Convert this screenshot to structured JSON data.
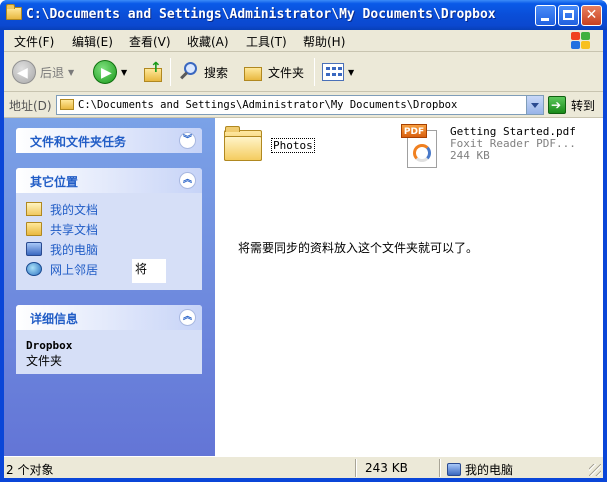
{
  "window": {
    "title": "C:\\Documents and Settings\\Administrator\\My Documents\\Dropbox"
  },
  "menubar": {
    "items": [
      "文件(F)",
      "编辑(E)",
      "查看(V)",
      "收藏(A)",
      "工具(T)",
      "帮助(H)"
    ]
  },
  "toolbar": {
    "back_label": "后退",
    "search_label": "搜索",
    "folders_label": "文件夹"
  },
  "addressbar": {
    "label": "地址(D)",
    "value": "C:\\Documents and Settings\\Administrator\\My Documents\\Dropbox",
    "go_label": "转到"
  },
  "tasks": {
    "file_tasks": {
      "title": "文件和文件夹任务"
    },
    "other_places": {
      "title": "其它位置",
      "links": [
        {
          "label": "我的文档",
          "icon": "my-documents-icon"
        },
        {
          "label": "共享文档",
          "icon": "shared-folder-icon"
        },
        {
          "label": "我的电脑",
          "icon": "my-computer-icon"
        },
        {
          "label": "网上邻居",
          "icon": "network-places-icon"
        }
      ]
    },
    "details": {
      "title": "详细信息",
      "name": "Dropbox",
      "type": "文件夹"
    }
  },
  "tooltip": {
    "text": "将"
  },
  "content": {
    "items": [
      {
        "name": "Photos",
        "kind": "folder"
      },
      {
        "name": "Getting Started.pdf",
        "kind": "Foxit Reader PDF...",
        "size": "244 KB"
      }
    ],
    "message": "将需要同步的资料放入这个文件夹就可以了。"
  },
  "statusbar": {
    "count": "2 个对象",
    "size": "243 KB",
    "location": "我的电脑"
  },
  "colors": {
    "title_blue": "#0a4ed8",
    "task_pane_top": "#7ba2e7",
    "task_pane_bottom": "#6375d6",
    "link_blue": "#215dc6",
    "chrome": "#ece9d8"
  }
}
